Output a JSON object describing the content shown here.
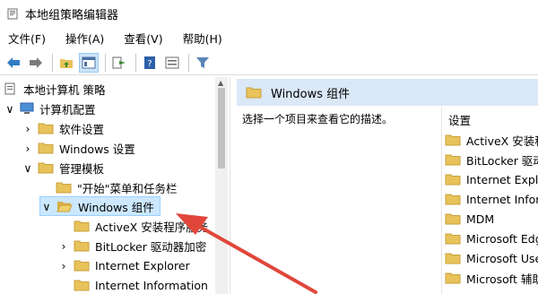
{
  "window": {
    "title": "本地组策略编辑器"
  },
  "menu": [
    "文件(F)",
    "操作(A)",
    "查看(V)",
    "帮助(H)"
  ],
  "toolbar_icons": [
    "back-arrow-icon",
    "forward-arrow-icon",
    "up-folder-icon",
    "show-hide-tree-icon",
    "export-list-icon",
    "help-icon",
    "properties-icon",
    "filter-icon"
  ],
  "tree": [
    {
      "label": "本地计算机 策略",
      "icon": "computer-policy-icon",
      "chev": ""
    },
    {
      "label": "计算机配置",
      "icon": "computer-icon",
      "chev": "∨"
    },
    {
      "label": "软件设置",
      "icon": "folder-icon",
      "chev": "›"
    },
    {
      "label": "Windows 设置",
      "icon": "folder-icon",
      "chev": "›"
    },
    {
      "label": "管理模板",
      "icon": "folder-icon",
      "chev": "∨"
    },
    {
      "label": "\"开始\"菜单和任务栏",
      "icon": "folder-icon",
      "chev": ""
    },
    {
      "label": "Windows 组件",
      "icon": "folder-open-icon",
      "chev": "∨"
    },
    {
      "label": "ActiveX 安装程序服务",
      "icon": "folder-icon",
      "chev": ""
    },
    {
      "label": "BitLocker 驱动器加密",
      "icon": "folder-icon",
      "chev": "›"
    },
    {
      "label": "Internet Explorer",
      "icon": "folder-icon",
      "chev": "›"
    },
    {
      "label": "Internet Information",
      "icon": "folder-icon",
      "chev": ""
    }
  ],
  "right": {
    "header": "Windows 组件",
    "description": "选择一个项目来查看它的描述。",
    "settings_heading": "设置",
    "items": [
      "ActiveX 安装程",
      "BitLocker 驱动",
      "Internet Explo",
      "Internet Inforr",
      "MDM",
      "Microsoft Edg",
      "Microsoft Use",
      "Microsoft 辅助"
    ]
  },
  "colors": {
    "folder": "#e8c25a",
    "header_bg": "#dae8f8",
    "selection": "#cce8ff",
    "annotation_arrow": "#e0473a"
  }
}
